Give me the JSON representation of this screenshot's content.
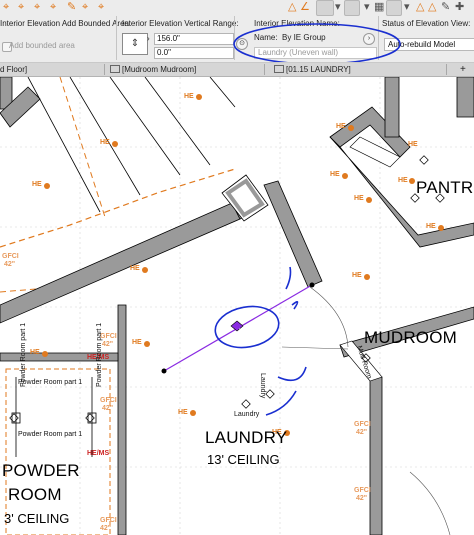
{
  "toolbar": {
    "add_bounded_area_label": "Interior Elevation Add Bounded Area:",
    "add_bounded_area_checkbox": "Add bounded area",
    "vertical_range_label": "Interior Elevation Vertical Range:",
    "vertical_range_top": "156.0\"",
    "vertical_range_bottom": "0.0\"",
    "name_label": "Interior Elevation Name:",
    "name_prefix": "Name:",
    "name_value": "By IE Group",
    "name_description": "Laundry (Uneven wall)",
    "status_label": "Status of Elevation View:",
    "status_value": "Auto-rebuild Model"
  },
  "tabs": [
    {
      "label": "d Floor]"
    },
    {
      "label": "[Mudroom Mudroom]"
    },
    {
      "label": "[01.15 LAUNDRY]"
    },
    {
      "label": "+"
    }
  ],
  "plan": {
    "rooms": [
      {
        "name": "LAUNDRY",
        "sub": "13' CEILING"
      },
      {
        "name": "MUDROOM",
        "sub": ""
      },
      {
        "name": "PANTR",
        "sub": ""
      },
      {
        "name": "POWDER",
        "sub": ""
      },
      {
        "name": "ROOM",
        "sub": "3' CEILING"
      }
    ],
    "he_tag": "HE",
    "hems_tag": "HE/MS",
    "gfci_tag": "GFCI",
    "gfci_h": "42\"",
    "laundry_small": "Laundry",
    "powder_part": "Powder Room part 1",
    "mud_room_small": "Mud Room"
  },
  "colors": {
    "orange": "#e07a1f",
    "blue_annotation": "#1a2fd0",
    "marker_purple": "#8a2be2",
    "wall_gray": "#8c8c8c"
  }
}
